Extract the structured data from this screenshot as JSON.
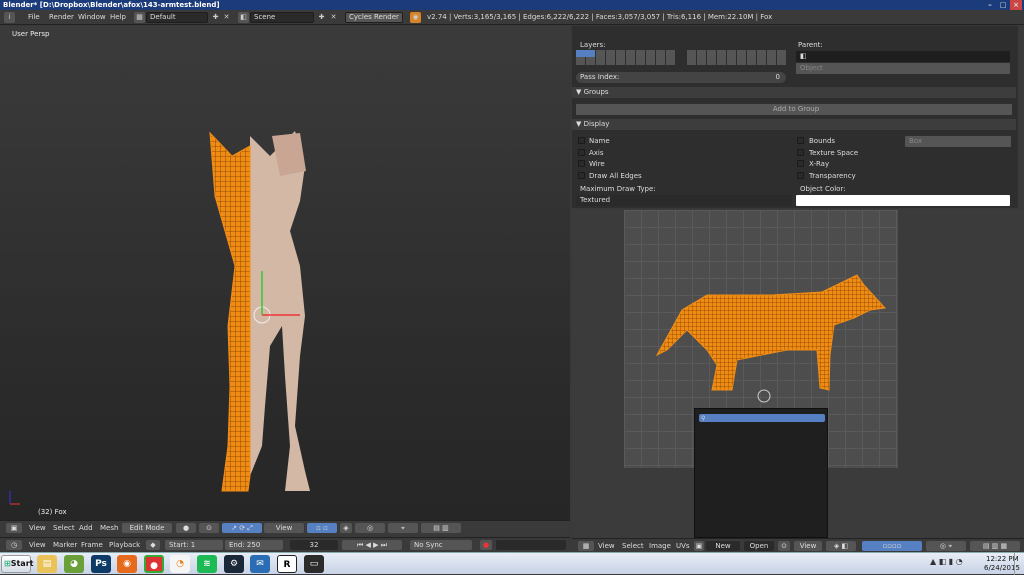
{
  "window": {
    "title": "Blender* [D:\\Dropbox\\Blender\\afox\\143-armtest.blend]"
  },
  "menubar": {
    "items": [
      "File",
      "Render",
      "Window",
      "Help"
    ],
    "layout": "Default",
    "scene": "Scene",
    "engine": "Cycles Render",
    "stats": "v2.74 | Verts:3,165/3,165 | Edges:6,222/6,222 | Faces:3,057/3,057 | Tris:6,116 | Mem:22.10M | Fox"
  },
  "viewport": {
    "label": "User Persp",
    "object_label": "(32) Fox"
  },
  "viewport_header": {
    "items": [
      "View",
      "Select",
      "Add",
      "Mesh"
    ],
    "mode": "Edit Mode",
    "orientation": "View"
  },
  "timeline": {
    "items": [
      "View",
      "Marker",
      "Frame",
      "Playback"
    ],
    "start_label": "Start:",
    "start": "1",
    "end_label": "End:",
    "end": "250",
    "current": "32",
    "sync": "No Sync"
  },
  "properties": {
    "layers_label": "Layers:",
    "parent_label": "Parent:",
    "parent_type": "Object",
    "pass_index_label": "Pass Index:",
    "pass_index": "0",
    "groups_header": "Groups",
    "add_to_group": "Add to Group",
    "display_header": "Display",
    "left_checks": [
      "Name",
      "Axis",
      "Wire",
      "Draw All Edges"
    ],
    "right_checks": [
      "Bounds",
      "Texture Space",
      "X-Ray",
      "Transparency"
    ],
    "bounds_type": "Box",
    "max_draw_type_label": "Maximum Draw Type:",
    "max_draw_type": "Textured",
    "object_color_label": "Object Color:",
    "object_color": "#ffffff"
  },
  "uv_header": {
    "items": [
      "View",
      "Select",
      "Image",
      "UVs"
    ],
    "new_label": "New",
    "open_label": "Open",
    "view_label": "View"
  },
  "taskbar": {
    "start_label": "Start",
    "time": "12:22 PM",
    "date": "6/24/2015",
    "apps": [
      "explorer",
      "paint",
      "photoshop",
      "firefox",
      "chrome",
      "blender",
      "spotify",
      "steam",
      "thunderbird",
      "r-studio",
      "console"
    ]
  },
  "colors": {
    "accent": "#f08c14",
    "titlebar": "#1c3b7a",
    "selected": "#5680c2"
  }
}
